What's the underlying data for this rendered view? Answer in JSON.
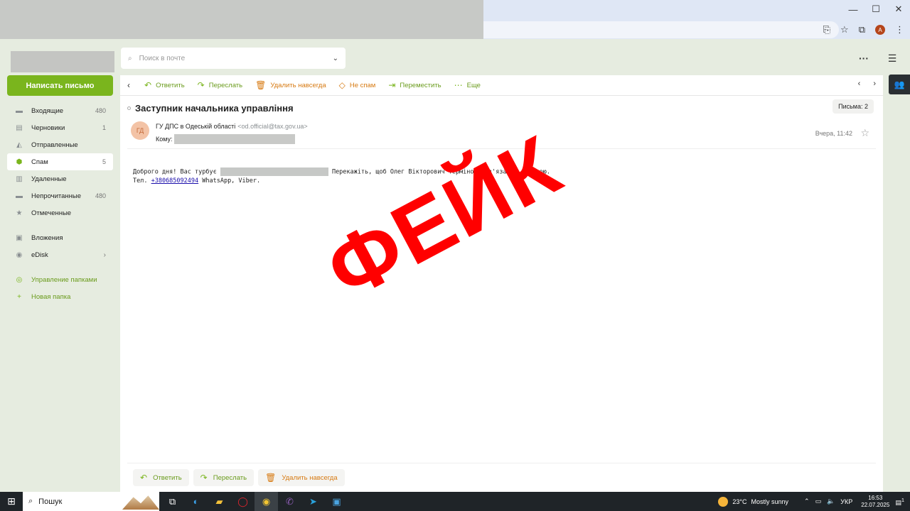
{
  "browser": {
    "window_controls": [
      "—",
      "☐",
      "✕"
    ],
    "profile_initial": "A"
  },
  "header": {
    "search_placeholder": "Поиск в почте",
    "more_icon": "more-horizontal-icon",
    "menu_icon": "hamburger-icon"
  },
  "sidebar": {
    "compose_label": "Написать письмо",
    "folders": [
      {
        "label": "Входящие",
        "count": "480",
        "icon": "inbox-icon"
      },
      {
        "label": "Черновики",
        "count": "1",
        "icon": "draft-icon"
      },
      {
        "label": "Отправленные",
        "count": "",
        "icon": "sent-icon"
      },
      {
        "label": "Спам",
        "count": "5",
        "icon": "spam-icon",
        "active": true
      },
      {
        "label": "Удаленные",
        "count": "",
        "icon": "trash-icon"
      },
      {
        "label": "Непрочитанные",
        "count": "480",
        "icon": "unread-icon"
      },
      {
        "label": "Отмеченные",
        "count": "",
        "icon": "star-icon"
      }
    ],
    "extras": [
      {
        "label": "Вложения",
        "icon": "attachment-icon"
      },
      {
        "label": "eDisk",
        "icon": "disk-icon"
      }
    ],
    "actions": [
      {
        "label": "Управление папками",
        "icon": "manage-folders-icon"
      },
      {
        "label": "Новая папка",
        "icon": "plus-icon"
      }
    ]
  },
  "toolbar": {
    "reply": "Ответить",
    "forward": "Переслать",
    "delete": "Удалить навсегда",
    "not_spam": "Не спам",
    "move": "Переместить",
    "more": "Еще"
  },
  "message": {
    "subject": "Заступник начальника управління",
    "count_label": "Письма: 2",
    "sender_initials": "ГД",
    "sender_name": "ГУ ДПС в Одеській області",
    "sender_email": "<od.official@tax.gov.ua>",
    "to_label": "Кому:",
    "time": "Вчера, 11:42",
    "body_line1_start": "Доброго дня! Вас турбує ",
    "body_line1_end": " Перекажіть, щоб Олег Вікторович терміново зв'язався зі мною.",
    "body_line2_prefix": "Тел. ",
    "body_phone": "+380685092494",
    "body_line2_suffix": " WhatsApp, Viber."
  },
  "stamp_text": "ФЕЙК",
  "bottom_actions": {
    "reply": "Ответить",
    "forward": "Переслать",
    "delete": "Удалить навсегда"
  },
  "taskbar": {
    "search_label": "Пошук",
    "temperature": "23°C",
    "weather": "Mostly sunny",
    "language": "УКР",
    "time": "16:53",
    "date": "22.07.2025",
    "notification_count": "1"
  },
  "colors": {
    "accent_green": "#7ab51d",
    "warning_orange": "#d77a12",
    "stamp_red": "#ff0000"
  }
}
